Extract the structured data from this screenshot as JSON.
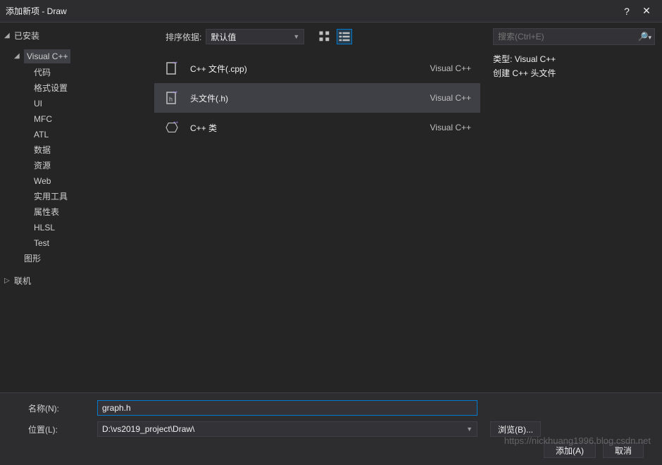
{
  "window": {
    "title": "添加新项 - Draw"
  },
  "tree": {
    "installed_label": "已安装",
    "vcpp_label": "Visual C++",
    "items": [
      "代码",
      "格式设置",
      "UI",
      "MFC",
      "ATL",
      "数据",
      "资源",
      "Web",
      "实用工具",
      "属性表",
      "HLSL",
      "Test"
    ],
    "graphics_label": "图形",
    "online_label": "联机"
  },
  "toolbar": {
    "sort_label": "排序依据:",
    "sort_value": "默认值"
  },
  "templates": [
    {
      "name": "C++ 文件(.cpp)",
      "type": "Visual C++",
      "icon": "cpp-file-icon"
    },
    {
      "name": "头文件(.h)",
      "type": "Visual C++",
      "icon": "header-file-icon"
    },
    {
      "name": "C++ 类",
      "type": "Visual C++",
      "icon": "cpp-class-icon"
    }
  ],
  "search": {
    "placeholder": "搜索(Ctrl+E)"
  },
  "details": {
    "type_label": "类型:",
    "type_value": "Visual C++",
    "desc": "创建 C++ 头文件"
  },
  "form": {
    "name_label": "名称(N):",
    "name_value": "graph.h",
    "location_label": "位置(L):",
    "location_value": "D:\\vs2019_project\\Draw\\",
    "browse_label": "浏览(B)...",
    "add_label": "添加(A)",
    "cancel_label": "取消"
  },
  "watermark": "https://nickhuang1996.blog.csdn.net"
}
